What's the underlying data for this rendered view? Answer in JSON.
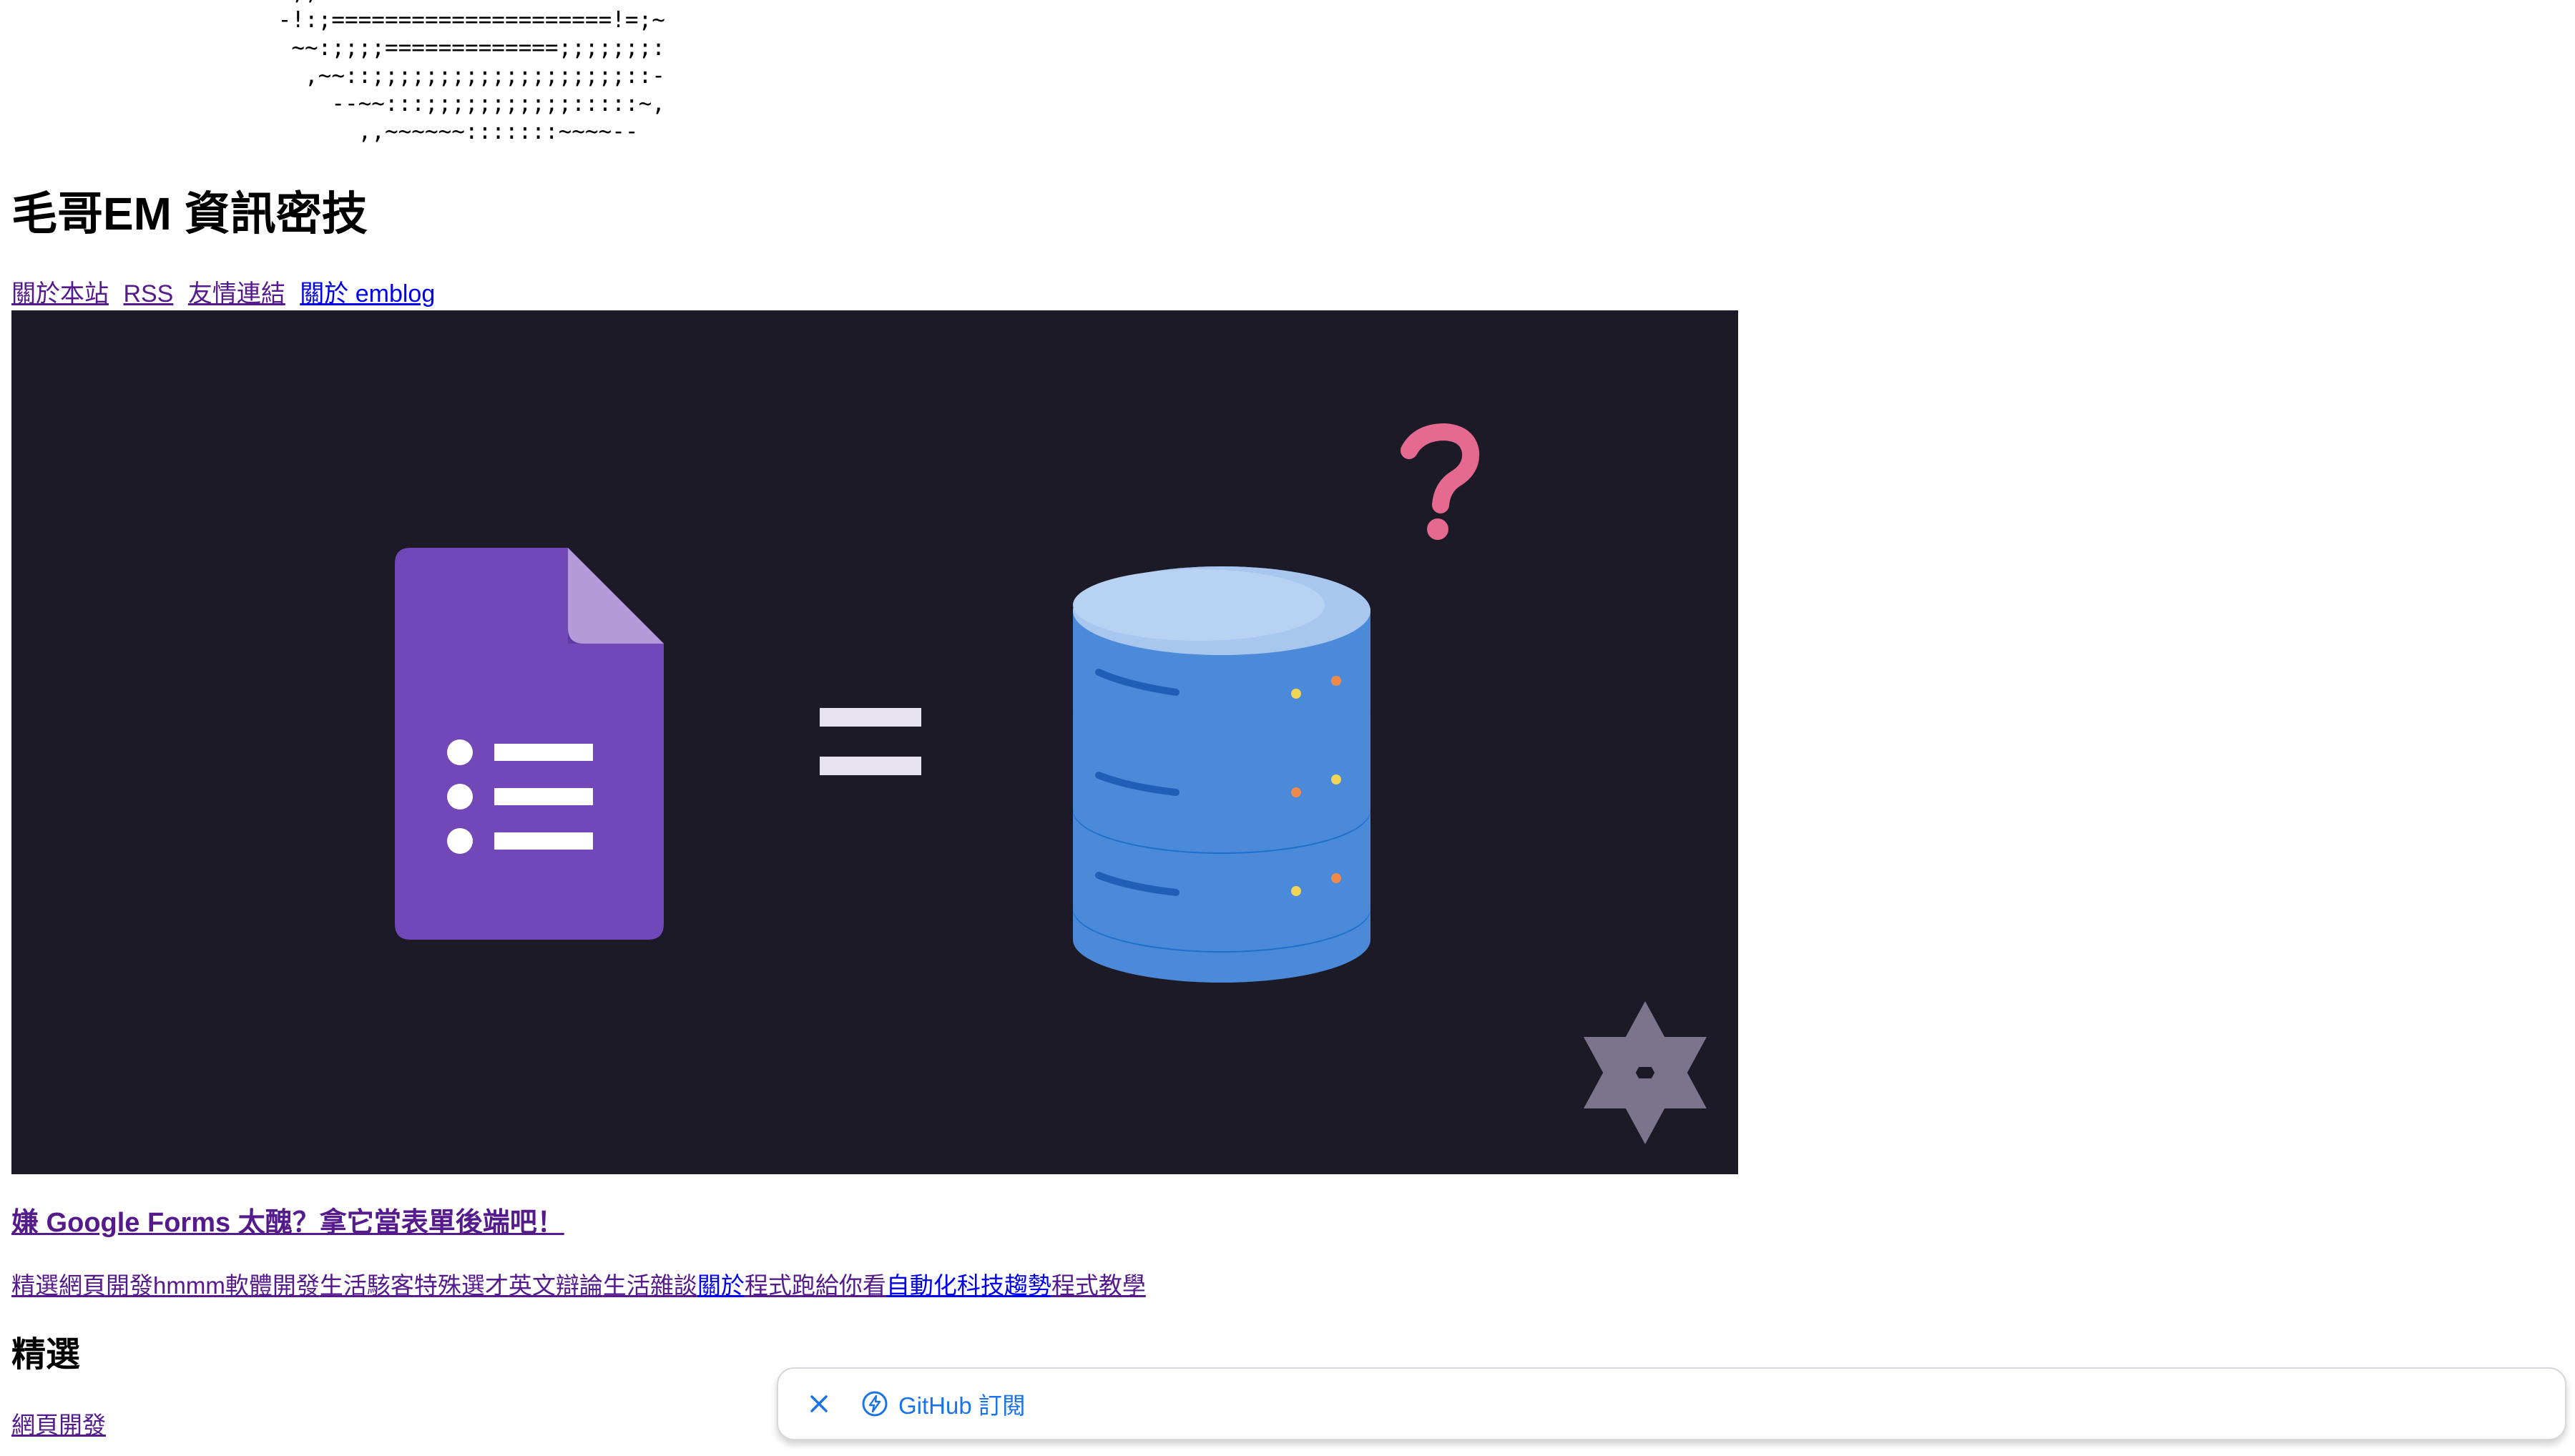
{
  "ascii_art": {
    "lines": [
      "~:;;===!!!!!==============!!*!=!",
      " -!:;=====================!=;~",
      "  ~~:;;;;=============;;;;;;;:",
      "   ,~~::;;;;;;;;;;;;;;;;;;;::-",
      "     --~~:::;;;;;;;;;;;:::::~,",
      "       ,,~~~~~~:::::::~~~~--"
    ]
  },
  "site": {
    "title": "毛哥EM 資訊密技"
  },
  "nav": [
    {
      "label": "關於本站",
      "visited": true
    },
    {
      "label": "RSS",
      "visited": true
    },
    {
      "label": "友情連結",
      "visited": true
    },
    {
      "label": "關於 emblog",
      "visited": false
    }
  ],
  "hero": {
    "form_icon": "google-forms-icon",
    "equals_icon": "equals-icon",
    "database_icon": "database-icon",
    "question_icon": "question-mark-icon",
    "logo_icon": "star-logo-icon",
    "colors": {
      "background": "#1c1a26",
      "form_purple": "#7248b9",
      "database_blue": "#4a8ad8",
      "question_pink": "#e66a8f"
    }
  },
  "featured_post": {
    "title": "嫌 Google Forms 太醜？拿它當表單後端吧！"
  },
  "categories": [
    {
      "label": "精選",
      "visited": true
    },
    {
      "label": "網頁開發",
      "visited": true
    },
    {
      "label": "hmmm",
      "visited": true
    },
    {
      "label": "軟體開發",
      "visited": true
    },
    {
      "label": "生活駭客",
      "visited": true
    },
    {
      "label": "特殊選才",
      "visited": true
    },
    {
      "label": "英文辯論",
      "visited": true
    },
    {
      "label": "生活雜談",
      "visited": true
    },
    {
      "label": "關於",
      "visited": false
    },
    {
      "label": "程式跑給你看",
      "visited": true
    },
    {
      "label": "自動化",
      "visited": false
    },
    {
      "label": "科技趨勢",
      "visited": false
    },
    {
      "label": "程式教學",
      "visited": true
    }
  ],
  "section": {
    "title": "精選"
  },
  "section_links": [
    {
      "label": "網頁開發"
    }
  ],
  "subscribe_bar": {
    "close_icon": "close-icon",
    "subscribe_icon": "bolt-circle-icon",
    "label": "GitHub 訂閱",
    "accent": "#1a73e8"
  }
}
